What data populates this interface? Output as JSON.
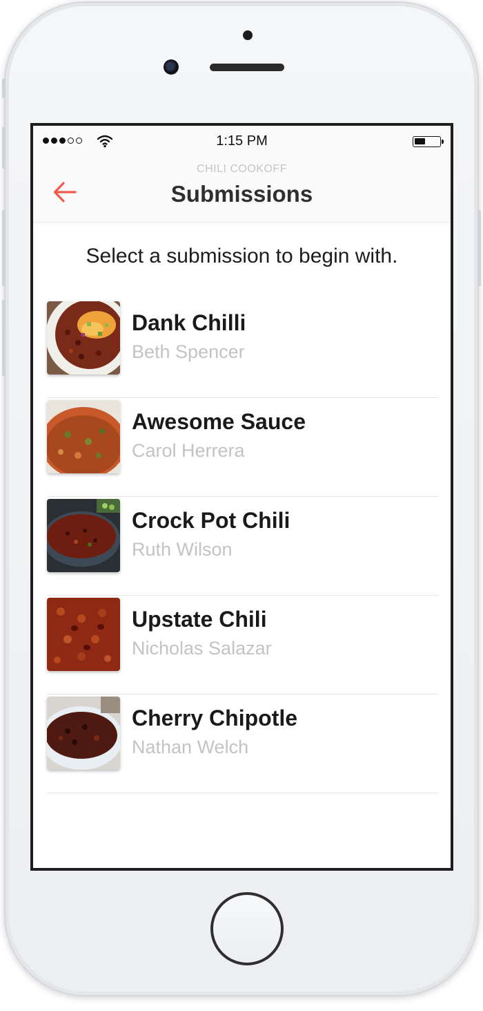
{
  "status_bar": {
    "time": "1:15 PM",
    "battery_level": 0.45,
    "signal_bars_filled": 3,
    "signal_bars_total": 5
  },
  "nav": {
    "overtitle": "CHILI COOKOFF",
    "title": "Submissions",
    "back_icon": "back-arrow-icon"
  },
  "instruction": "Select a submission to begin with.",
  "submissions": [
    {
      "title": "Dank Chilli",
      "author": "Beth Spencer"
    },
    {
      "title": "Awesome Sauce",
      "author": "Carol Herrera"
    },
    {
      "title": "Crock Pot Chili",
      "author": "Ruth Wilson"
    },
    {
      "title": "Upstate Chili",
      "author": "Nicholas Salazar"
    },
    {
      "title": "Cherry Chipotle",
      "author": "Nathan Welch"
    }
  ],
  "colors": {
    "accent": "#ef5a4a",
    "title": "#2f2f2f",
    "subtitle": "#c3c3c3"
  }
}
